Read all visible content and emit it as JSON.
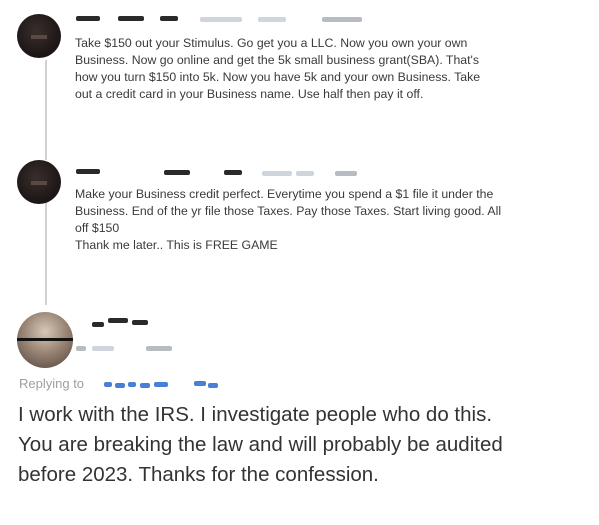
{
  "comments": [
    {
      "text": "Take $150 out your Stimulus. Go get you a LLC. Now you own your own\nBusiness. Now go online and get the 5k small business grant(SBA). That's\nhow you turn $150 into 5k. Now you have 5k and your own Business. Take\nout a credit card in your Business name. Use half then pay it off."
    },
    {
      "text": "Make your Business credit perfect. Everytime you spend a $1 file it under the\nBusiness. End of the yr file those Taxes. Pay those Taxes. Start living good. All\noff $150\nThank me later.. This is FREE GAME"
    }
  ],
  "reply": {
    "replying_to_label": "Replying to",
    "text": "I work with the IRS. I investigate people who do this.\nYou are breaking the law and will probably be audited\nbefore 2023. Thanks for the confession."
  },
  "colors": {
    "background": "#ffffff",
    "link_blue": "#4a7fd8",
    "muted_grey": "#9aa0a6"
  },
  "icons": {
    "avatar_1": "profile-avatar-icon",
    "avatar_2": "profile-avatar-icon",
    "avatar_3": "profile-photo-avatar"
  }
}
